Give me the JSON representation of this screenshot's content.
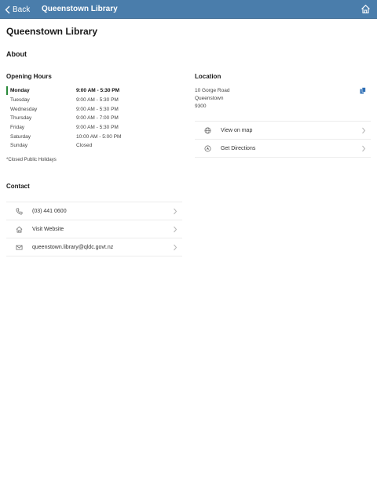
{
  "nav": {
    "back_label": "Back",
    "title": "Queenstown Library"
  },
  "page": {
    "title": "Queenstown Library",
    "about_heading": "About"
  },
  "hours": {
    "title": "Opening Hours",
    "rows": [
      {
        "day": "Monday",
        "time": "9:00 AM - 5:30 PM",
        "today": true
      },
      {
        "day": "Tuesday",
        "time": "9:00 AM - 5:30 PM"
      },
      {
        "day": "Wednesday",
        "time": "9:00 AM - 5:30 PM"
      },
      {
        "day": "Thursday",
        "time": "9:00 AM - 7:00 PM"
      },
      {
        "day": "Friday",
        "time": "9:00 AM - 5:30 PM"
      },
      {
        "day": "Saturday",
        "time": "10:00 AM - 5:00 PM"
      },
      {
        "day": "Sunday",
        "time": "Closed"
      }
    ],
    "note": "*Closed Public Holidays"
  },
  "contact": {
    "title": "Contact",
    "items": [
      {
        "label": "(03) 441 0600",
        "icon": "phone-icon"
      },
      {
        "label": "Visit Website",
        "icon": "home-icon"
      },
      {
        "label": "queenstown.library@qldc.govt.nz",
        "icon": "mail-icon"
      }
    ]
  },
  "location": {
    "title": "Location",
    "address_lines": [
      "10 Gorge Road",
      "Queenstown",
      "9300"
    ],
    "items": [
      {
        "label": "View on map",
        "icon": "globe-icon"
      },
      {
        "label": "Get Directions",
        "icon": "directions-icon"
      }
    ]
  },
  "colors": {
    "nav_bar": "#4a7dab",
    "today_marker": "#2a8a3a",
    "copy_icon": "#2f6fb5"
  }
}
